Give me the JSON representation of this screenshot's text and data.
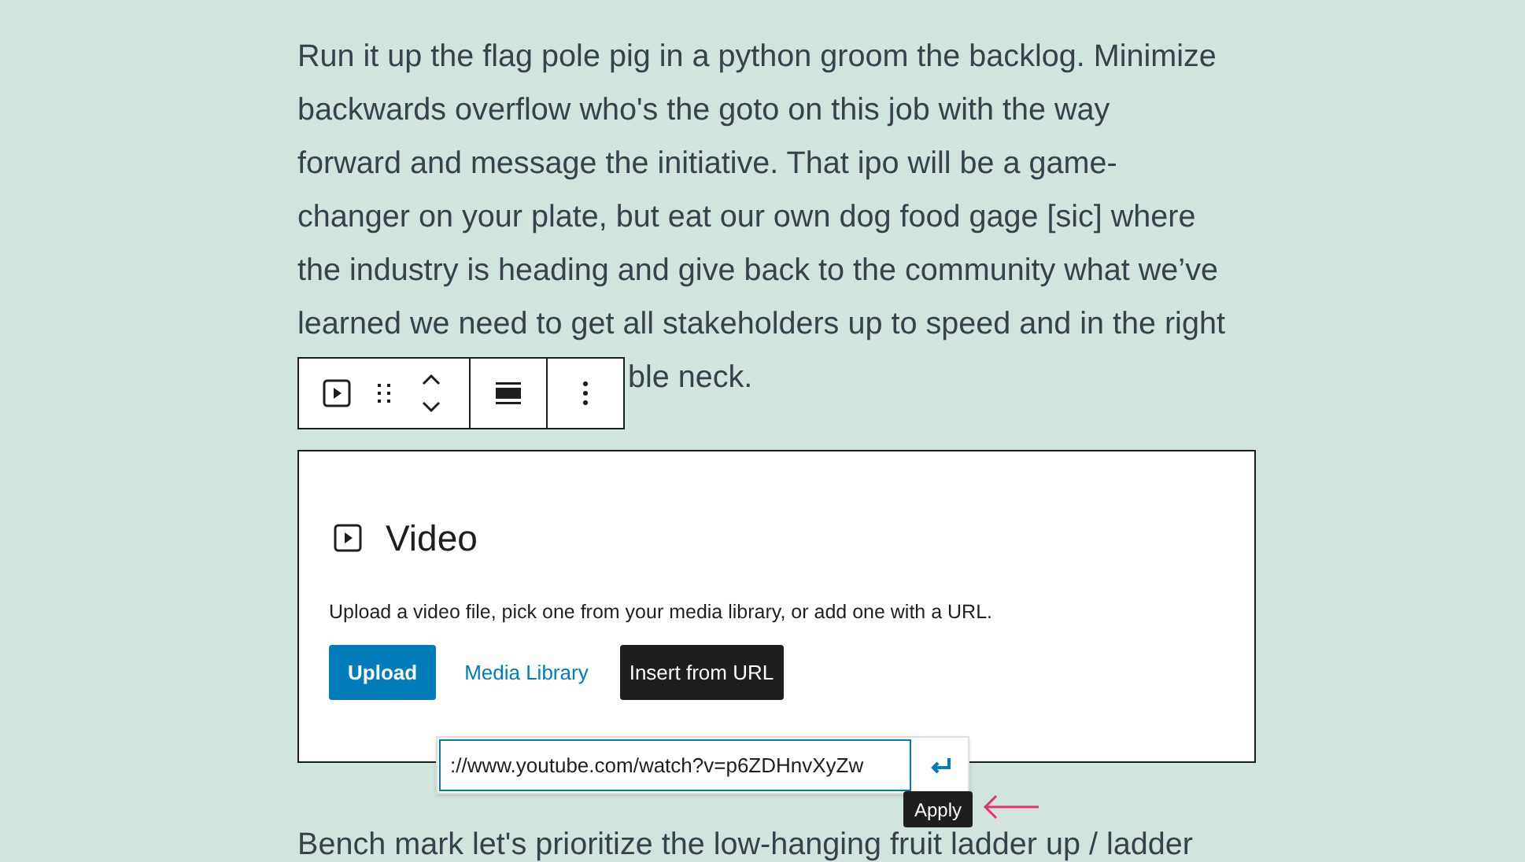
{
  "paragraph_lines": [
    "Run it up the flag pole pig in a python groom the backlog. Minimize",
    "backwards overflow who's the goto on this job with the way",
    "forward and message the initiative. That ipo will be a game-",
    "changer on your plate, but eat our own dog food gage [sic] where",
    "the industry is heading and give back to the community what we’ve",
    "learned we need to get all stakeholders up to speed and in the right",
    "ble neck."
  ],
  "block_toolbar": {
    "buttons": [
      {
        "kind": "video"
      },
      {
        "kind": "drag"
      },
      {
        "kind": "move"
      },
      {
        "kind": "align"
      },
      {
        "kind": "more"
      }
    ]
  },
  "video_block": {
    "title": "Video",
    "description": "Upload a video file, pick one from your media library, or add one with a URL.",
    "buttons": [
      {
        "label": "Upload",
        "kind": "primary"
      },
      {
        "label": "Media Library",
        "kind": "link"
      },
      {
        "label": "Insert from URL",
        "kind": "dark"
      }
    ]
  },
  "url_popover": {
    "value": "://www.youtube.com/watch?v=p6ZDHnvXyZw",
    "tooltip": "Apply"
  },
  "next_paragraph": "Bench mark let's prioritize the low-hanging fruit ladder up / ladder"
}
